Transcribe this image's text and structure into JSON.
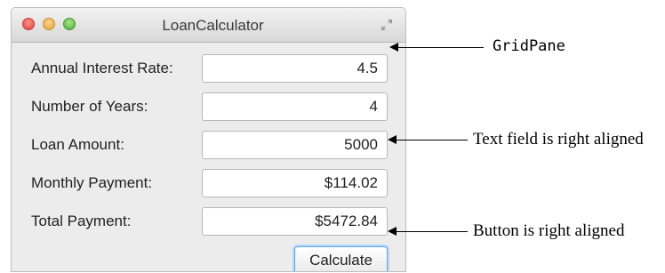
{
  "window": {
    "title": "LoanCalculator"
  },
  "form": {
    "rows": [
      {
        "label": "Annual Interest Rate:",
        "value": "4.5"
      },
      {
        "label": "Number of Years:",
        "value": "4"
      },
      {
        "label": "Loan Amount:",
        "value": "5000"
      },
      {
        "label": "Monthly Payment:",
        "value": "$114.02"
      },
      {
        "label": "Total Payment:",
        "value": "$5472.84"
      }
    ],
    "calculate_label": "Calculate"
  },
  "annotations": {
    "gridpane": "GridPane",
    "textfield": "Text field is right aligned",
    "button": "Button is right aligned"
  },
  "icons": {
    "close": "close-button",
    "minimize": "minimize-button",
    "zoom": "zoom-button",
    "fullscreen": "fullscreen-icon"
  }
}
